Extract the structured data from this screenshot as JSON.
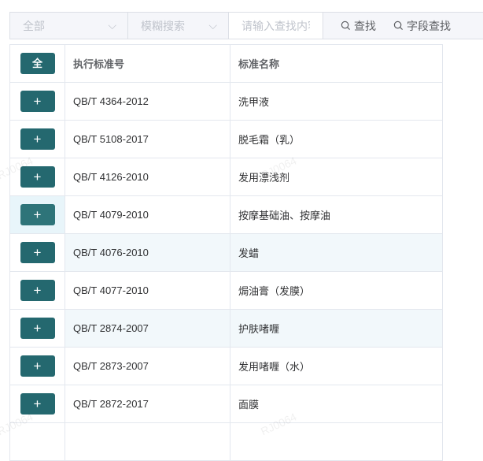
{
  "toolbar": {
    "category": "全部",
    "mode": "模糊搜索",
    "search_placeholder": "请输入查找内容",
    "find_label": "查找",
    "field_find_label": "字段查找"
  },
  "table": {
    "select_all_label": "全",
    "add_label": "+",
    "headers": [
      "执行标准号",
      "标准名称"
    ],
    "rows": [
      {
        "code": "QB/T 4364-2012",
        "name": "洗甲液"
      },
      {
        "code": "QB/T 5108-2017",
        "name": "脱毛霜（乳）"
      },
      {
        "code": "QB/T 4126-2010",
        "name": "发用漂浅剂"
      },
      {
        "code": "QB/T 4079-2010",
        "name": "按摩基础油、按摩油"
      },
      {
        "code": "QB/T 4076-2010",
        "name": "发蜡"
      },
      {
        "code": "QB/T 4077-2010",
        "name": "焗油膏（发膜）"
      },
      {
        "code": "QB/T 2874-2007",
        "name": "护肤啫喱"
      },
      {
        "code": "QB/T 2873-2007",
        "name": "发用啫喱（水）"
      },
      {
        "code": "QB/T 2872-2017",
        "name": "面膜"
      },
      {
        "code": "",
        "name": ""
      }
    ]
  }
}
